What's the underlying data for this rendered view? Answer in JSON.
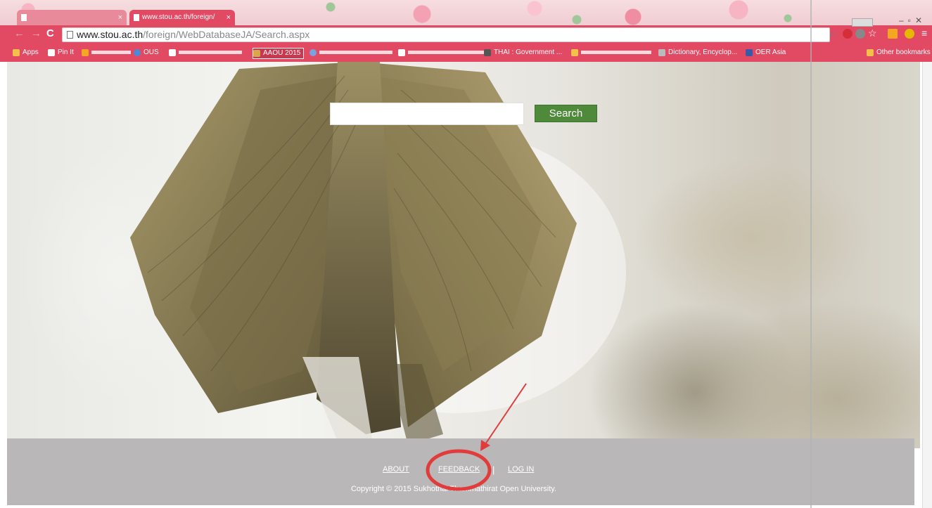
{
  "browser": {
    "tabs": [
      {
        "label": ""
      },
      {
        "label": "www.stou.ac.th/foreign/"
      }
    ],
    "url_host": "www.stou.ac.th",
    "url_path": "/foreign/WebDatabaseJA/Search.aspx",
    "bookmarks": [
      {
        "label": "Apps"
      },
      {
        "label": "Pin It"
      },
      {
        "label": "OUS"
      },
      {
        "label": "AAOU 2015"
      },
      {
        "label": "THAI : Government ..."
      },
      {
        "label": "Dictionary, Encyclop..."
      },
      {
        "label": "OER Asia"
      }
    ],
    "other_bookmarks": "Other bookmarks",
    "accent_color": "#e24a64"
  },
  "search": {
    "button_label": "Search",
    "input_value": "",
    "button_color": "#4f8a3a"
  },
  "footer": {
    "links": {
      "about": "ABOUT",
      "feedback": "FEEDBACK",
      "login": "LOG IN"
    },
    "separator": "|",
    "copyright": "Copyright © 2015 Sukhothai Thammathirat Open University.",
    "background_color": "#b9b7b7"
  },
  "annotation": {
    "highlight_target": "feedback",
    "color": "#e23b3b"
  }
}
